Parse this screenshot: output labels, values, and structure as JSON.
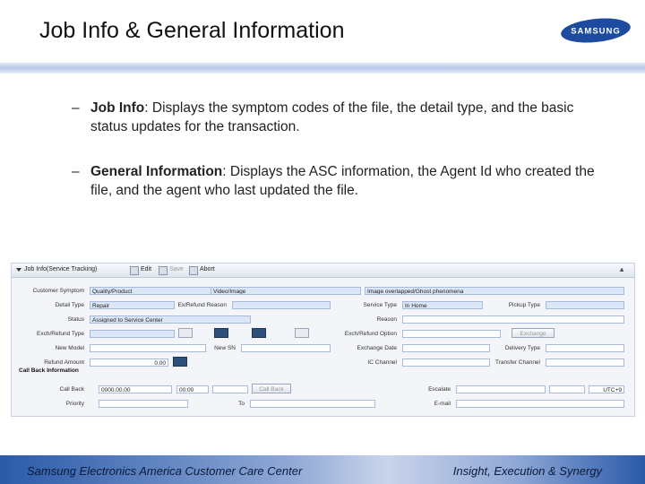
{
  "slide": {
    "title": "Job Info & General Information",
    "logo_text": "SAMSUNG",
    "bullets": [
      {
        "dash": "–",
        "term": "Job Info",
        "rest": ": Displays the symptom codes of the file, the detail type, and the basic status updates for the transaction."
      },
      {
        "dash": "–",
        "term": "General Information",
        "rest": ": Displays the ASC information, the Agent Id who created the file, and the agent who last updated the file."
      }
    ]
  },
  "app": {
    "header_title": "Job Info(Service Tracking)",
    "edit_label": "Edit",
    "save_label": "Save",
    "abort_label": "Abort",
    "labels": {
      "customer_symptom": "Customer Symptom",
      "detail_type": "Detail Type",
      "status": "Status",
      "exch_refund_type": "Exch/Refund Type",
      "new_model": "New Model",
      "refund_amount": "Refund Amount",
      "ex_refund_reason": "Ex/Refund Reason",
      "new_sn": "New SN",
      "service_type": "Service Type",
      "reason": "Reason",
      "exch_refund_option": "Exch/Refund Option",
      "exchange_date": "Exchange Date",
      "ic_channel": "IC Channel",
      "pickup_type": "Pickup Type",
      "delivery_type": "Delivery Type",
      "transfer_channel": "Transfer Channel",
      "call_back_info": "Call Back Information",
      "call_back": "Call Back",
      "priority": "Priority",
      "to": "To",
      "escalate": "Escalate",
      "email": "E-mail"
    },
    "values": {
      "symptom_1": "Quality/Product",
      "symptom_2": "Video/Image",
      "symptom_3": "Image overlapped/Ghost phenomena",
      "detail_type": "Repair",
      "status": "Assigned to Service Center",
      "service_type": "In Home",
      "refund_amount": "0.00",
      "call_back_1": "0000.00.00",
      "call_back_2": "00:00",
      "escalate_tz": "UTC+9"
    },
    "buttons": {
      "exchange": "Exchange",
      "call_back": "Call Back"
    }
  },
  "footer": {
    "left": "Samsung Electronics America Customer Care Center",
    "right": "Insight, Execution & Synergy"
  }
}
